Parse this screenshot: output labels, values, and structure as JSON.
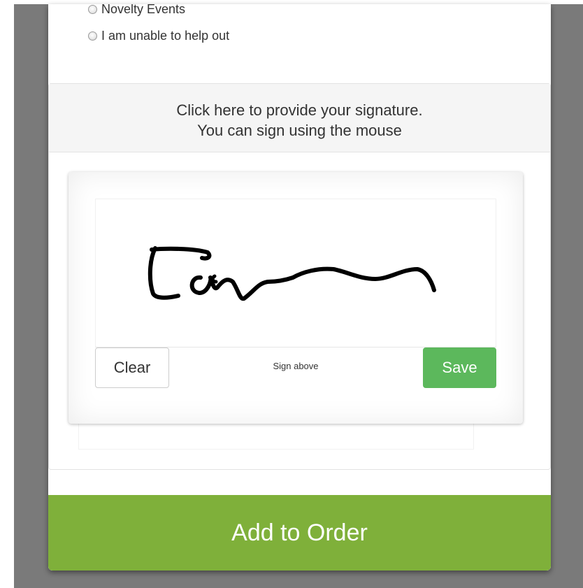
{
  "options": [
    {
      "label": "Novelty Events",
      "selected": false
    },
    {
      "label": "I am unable to help out",
      "selected": false
    }
  ],
  "signature": {
    "prompt_line1": "Click here to provide your signature.",
    "prompt_line2": "You can sign using the mouse",
    "clear_label": "Clear",
    "hint": "Sign above",
    "save_label": "Save",
    "save_color": "#5cb85c"
  },
  "add_button": {
    "label": "Add to Order",
    "color": "#7fb03a"
  }
}
